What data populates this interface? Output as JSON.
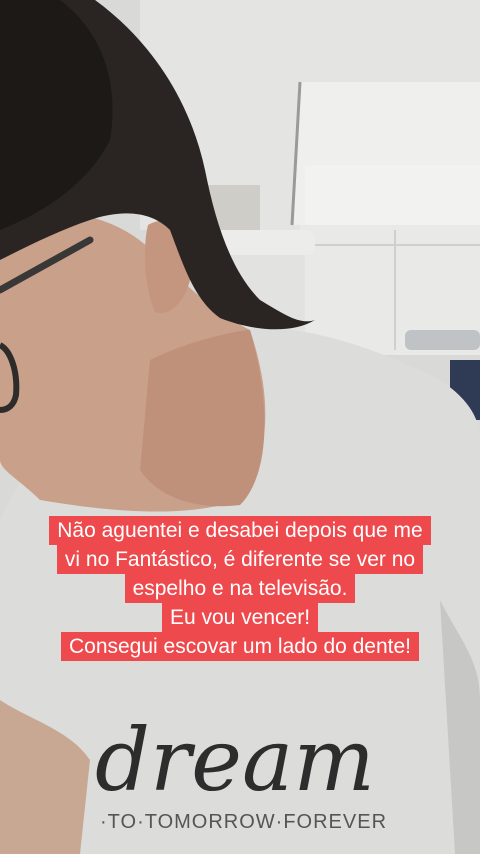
{
  "caption": {
    "lines": [
      "Não aguentei e desabei depois que me",
      "vi no Fantástico, é diferente se ver no",
      "espelho e na televisão.",
      "Eu vou vencer!",
      "Consegui escovar um lado do dente!"
    ],
    "background_color": "#ee4a4d",
    "text_color": "#ffffff"
  },
  "shirt_print": {
    "script_text": "dream",
    "small_text": "·TO·TOMORROW·FOREVER"
  }
}
